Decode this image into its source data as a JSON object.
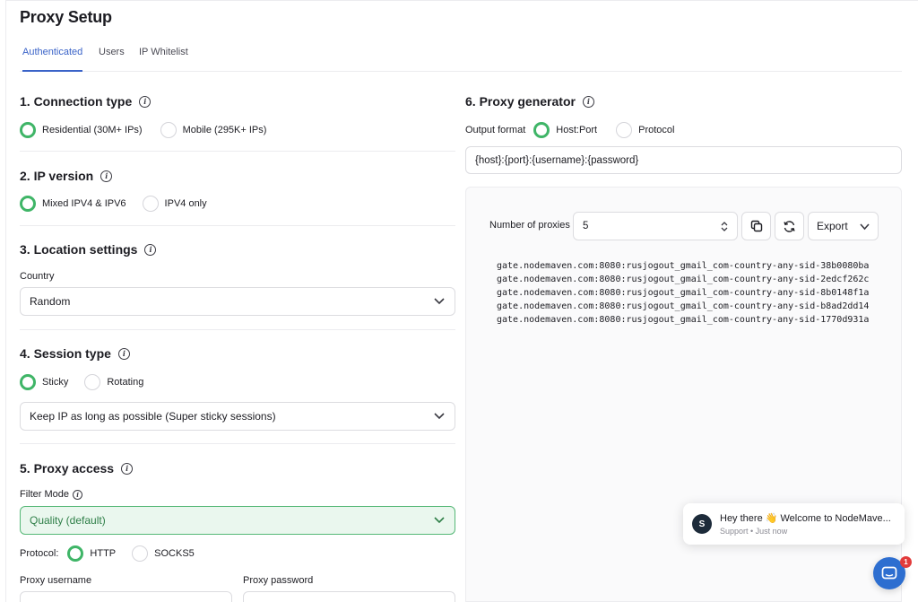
{
  "page": {
    "title": "Proxy Setup"
  },
  "tabs": [
    {
      "label": "Authenticated",
      "active": true
    },
    {
      "label": "Users",
      "active": false
    },
    {
      "label": "IP Whitelist",
      "active": false
    }
  ],
  "connection": {
    "title": "1. Connection type",
    "options": [
      "Residential (30M+ IPs)",
      "Mobile (295K+ IPs)"
    ],
    "selected": "Residential (30M+ IPs)"
  },
  "ip_version": {
    "title": "2. IP version",
    "options": [
      "Mixed IPV4 & IPV6",
      "IPV4 only"
    ],
    "selected": "Mixed IPV4 & IPV6"
  },
  "location": {
    "title": "3. Location settings",
    "country_label": "Country",
    "country_value": "Random"
  },
  "session": {
    "title": "4. Session type",
    "options": [
      "Sticky",
      "Rotating"
    ],
    "selected": "Sticky",
    "duration_value": "Keep IP as long as possible (Super sticky sessions)"
  },
  "access": {
    "title": "5. Proxy access",
    "filter_label": "Filter Mode",
    "filter_value": "Quality (default)",
    "protocol_label": "Protocol:",
    "protocol_options": [
      "HTTP",
      "SOCKS5"
    ],
    "protocol_selected": "HTTP",
    "username_label": "Proxy username",
    "password_label": "Proxy password"
  },
  "generator": {
    "title": "6. Proxy generator",
    "output_label": "Output format",
    "format_options": [
      "Host:Port",
      "Protocol"
    ],
    "format_selected": "Host:Port",
    "template": "{host}:{port}:{username}:{password}",
    "count_label": "Number of proxies",
    "count_value": "5",
    "export_label": "Export",
    "proxies": [
      "gate.nodemaven.com:8080:rusjogout_gmail_com-country-any-sid-38b0080ba",
      "gate.nodemaven.com:8080:rusjogout_gmail_com-country-any-sid-2edcf262c",
      "gate.nodemaven.com:8080:rusjogout_gmail_com-country-any-sid-8b0148f1a",
      "gate.nodemaven.com:8080:rusjogout_gmail_com-country-any-sid-b8ad2dd14",
      "gate.nodemaven.com:8080:rusjogout_gmail_com-country-any-sid-1770d931a"
    ]
  },
  "chat": {
    "avatar_letter": "S",
    "message": "Hey there 👋 Welcome to NodeMave...",
    "meta": "Support • Just now",
    "unread": "1"
  },
  "colors": {
    "accent_green": "#3fb567",
    "tab_active": "#3a63c8",
    "chat_blue": "#2d6ed0",
    "badge_red": "#e23b3b"
  }
}
